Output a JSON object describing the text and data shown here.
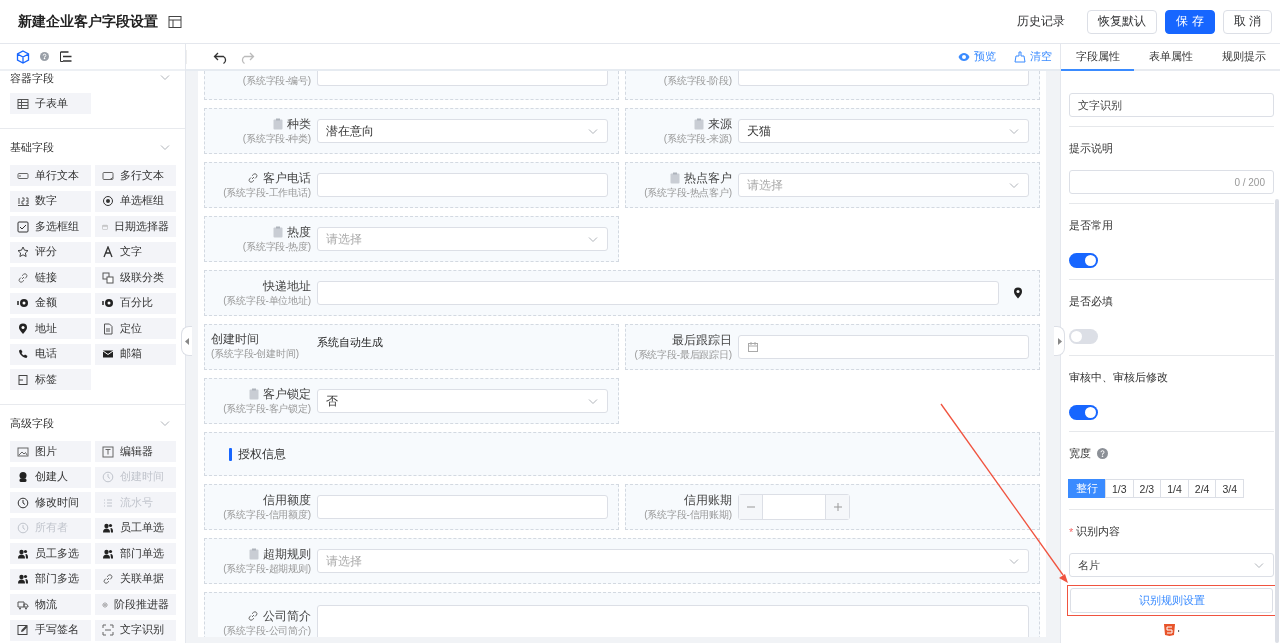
{
  "header": {
    "title": "新建企业客户字段设置",
    "history_link": "历史记录",
    "buttons": [
      {
        "label": "恢复默认",
        "kind": "default"
      },
      {
        "label": "保 存",
        "kind": "primary"
      },
      {
        "label": "取 消",
        "kind": "default"
      }
    ]
  },
  "sidebar": {
    "groups": [
      {
        "title": "容器字段",
        "items": [
          {
            "label": "子表单",
            "disabled": false
          }
        ]
      },
      {
        "title": "基础字段",
        "items": [
          {
            "label": "单行文本",
            "disabled": false
          },
          {
            "label": "多行文本",
            "disabled": false
          },
          {
            "label": "数字",
            "disabled": false
          },
          {
            "label": "单选框组",
            "disabled": false
          },
          {
            "label": "多选框组",
            "disabled": false
          },
          {
            "label": "日期选择器",
            "disabled": false
          },
          {
            "label": "评分",
            "disabled": false
          },
          {
            "label": "文字",
            "disabled": false
          },
          {
            "label": "链接",
            "disabled": false
          },
          {
            "label": "级联分类",
            "disabled": false
          },
          {
            "label": "金额",
            "disabled": false
          },
          {
            "label": "百分比",
            "disabled": false
          },
          {
            "label": "地址",
            "disabled": false
          },
          {
            "label": "定位",
            "disabled": false
          },
          {
            "label": "电话",
            "disabled": false
          },
          {
            "label": "邮箱",
            "disabled": false
          },
          {
            "label": "标签",
            "disabled": false
          }
        ]
      },
      {
        "title": "高级字段",
        "items": [
          {
            "label": "图片",
            "disabled": false
          },
          {
            "label": "编辑器",
            "disabled": false
          },
          {
            "label": "创建人",
            "disabled": false
          },
          {
            "label": "创建时间",
            "disabled": true
          },
          {
            "label": "修改时间",
            "disabled": false
          },
          {
            "label": "流水号",
            "disabled": true
          },
          {
            "label": "所有者",
            "disabled": true
          },
          {
            "label": "员工单选",
            "disabled": false
          },
          {
            "label": "员工多选",
            "disabled": false
          },
          {
            "label": "部门单选",
            "disabled": false
          },
          {
            "label": "部门多选",
            "disabled": false
          },
          {
            "label": "关联单据",
            "disabled": false
          },
          {
            "label": "物流",
            "disabled": false
          },
          {
            "label": "阶段推进器",
            "disabled": false
          },
          {
            "label": "手写签名",
            "disabled": false
          },
          {
            "label": "文字识别",
            "disabled": false
          }
        ]
      }
    ]
  },
  "toolbar": {
    "preview": "预览",
    "clear": "清空"
  },
  "fields": [
    {
      "kind": "partial",
      "full_width": false,
      "sublabel": "(系统字段-编号)"
    },
    {
      "kind": "partial",
      "full_width": false,
      "sublabel": "(系统字段-阶段)"
    },
    {
      "kind": "select",
      "full_width": false,
      "label": "种类",
      "sublabel": "(系统字段-种类)",
      "value": "潜在意向"
    },
    {
      "kind": "select",
      "full_width": false,
      "label": "来源",
      "sublabel": "(系统字段-来源)",
      "value": "天猫"
    },
    {
      "kind": "input",
      "full_width": false,
      "label": "客户电话",
      "sublabel": "(系统字段-工作电话)"
    },
    {
      "kind": "select",
      "full_width": false,
      "label": "热点客户",
      "sublabel": "(系统字段-热点客户)",
      "placeholder": "请选择"
    },
    {
      "kind": "select",
      "full_width": false,
      "label": "热度",
      "sublabel": "(系统字段-热度)",
      "placeholder": "请选择"
    },
    {
      "kind": "address",
      "full_width": true,
      "label": "快递地址",
      "sublabel": "(系统字段-单位地址)"
    },
    {
      "kind": "text",
      "full_width": false,
      "label": "创建时间",
      "sublabel": "(系统字段-创建时间)",
      "value": "系统自动生成"
    },
    {
      "kind": "date",
      "full_width": false,
      "label": "最后跟踪日",
      "sublabel": "(系统字段-最后跟踪日)"
    },
    {
      "kind": "select",
      "full_width": false,
      "label": "客户锁定",
      "sublabel": "(系统字段-客户锁定)",
      "value": "否"
    },
    {
      "kind": "section",
      "full_width": true,
      "label": "授权信息"
    },
    {
      "kind": "input",
      "full_width": false,
      "label": "信用额度",
      "sublabel": "(系统字段-信用额度)"
    },
    {
      "kind": "number",
      "full_width": false,
      "label": "信用账期",
      "sublabel": "(系统字段-信用账期)"
    },
    {
      "kind": "select",
      "full_width": true,
      "label": "超期规则",
      "sublabel": "(系统字段-超期规则)",
      "placeholder": "请选择"
    },
    {
      "kind": "textarea",
      "full_width": true,
      "label": "公司简介",
      "sublabel": "(系统字段-公司简介)"
    }
  ],
  "panel": {
    "tabs": [
      {
        "label": "字段属性",
        "selected": true
      },
      {
        "label": "表单属性",
        "selected": false
      },
      {
        "label": "规则提示",
        "selected": false
      }
    ],
    "props": [
      {
        "kind": "input",
        "value": "文字识别"
      },
      {
        "kind": "textarea",
        "label": "提示说明",
        "counter": "0 / 200"
      },
      {
        "kind": "toggle",
        "label": "是否常用",
        "on": true
      },
      {
        "kind": "toggle",
        "label": "是否必填",
        "on": false
      },
      {
        "kind": "toggle",
        "label": "审核中、审核后修改",
        "on": true
      },
      {
        "kind": "segmented",
        "label": "宽度",
        "options": [
          {
            "label": "整行",
            "selected": true
          },
          {
            "label": "1/3",
            "selected": false
          },
          {
            "label": "2/3",
            "selected": false
          },
          {
            "label": "1/4",
            "selected": false
          },
          {
            "label": "2/4",
            "selected": false
          },
          {
            "label": "3/4",
            "selected": false
          }
        ]
      },
      {
        "kind": "select",
        "label": "识别内容",
        "required": true,
        "required_mark": "*",
        "value": "名片"
      }
    ],
    "rule_button": {
      "label": "识别规则设置",
      "highlighted": true
    }
  }
}
